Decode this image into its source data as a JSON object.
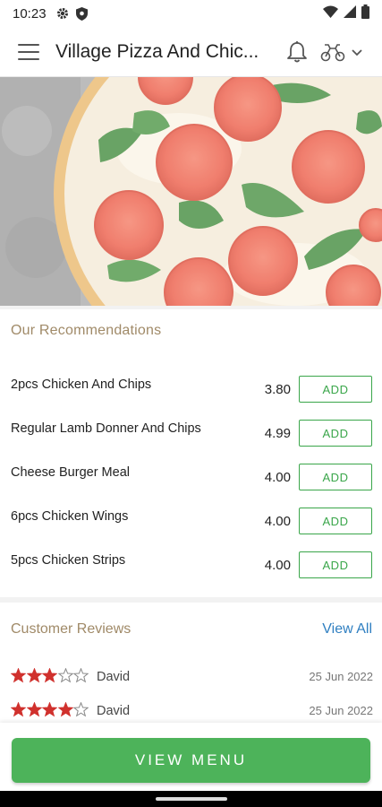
{
  "status_bar": {
    "time": "10:23",
    "left_icons": [
      "gear-icon",
      "shield-icon"
    ],
    "right_icons": [
      "wifi-icon",
      "signal-icon",
      "battery-icon"
    ]
  },
  "app_bar": {
    "title": "Village Pizza And Chic...",
    "icons": [
      "hamburger-menu-icon",
      "bell-icon",
      "delivery-scooter-icon",
      "chevron-down-icon"
    ]
  },
  "hero": {
    "image": "pizza-with-tomato-and-basil"
  },
  "recommendations": {
    "title": "Our Recommendations",
    "add_label": "ADD",
    "items": [
      {
        "name": "2pcs Chicken And Chips",
        "price": "3.80"
      },
      {
        "name": "Regular Lamb Donner And Chips",
        "price": "4.99"
      },
      {
        "name": "Cheese Burger Meal",
        "price": "4.00"
      },
      {
        "name": "6pcs Chicken Wings",
        "price": "4.00"
      },
      {
        "name": "5pcs Chicken Strips",
        "price": "4.00"
      }
    ]
  },
  "reviews": {
    "title": "Customer Reviews",
    "view_all": "View All",
    "items": [
      {
        "rating": 3,
        "max": 5,
        "name": "David",
        "date": "25 Jun 2022"
      },
      {
        "rating": 4,
        "max": 5,
        "name": "David",
        "date": "25 Jun 2022"
      }
    ]
  },
  "footer": {
    "view_menu": "VIEW MENU"
  },
  "colors": {
    "accent_green": "#4db35a",
    "add_green": "#3aa64a",
    "section_title": "#a08a68",
    "link_blue": "#2f7fc1",
    "star_red": "#d0312d"
  }
}
